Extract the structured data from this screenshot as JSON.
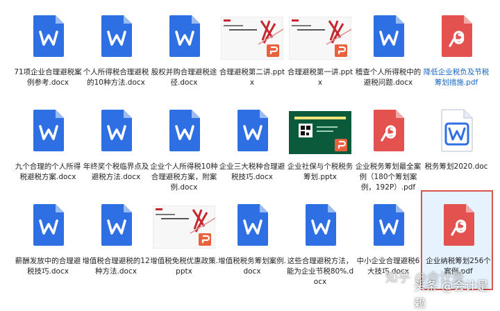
{
  "files": [
    {
      "name": "71项企业合理避税案例参考.docx",
      "type": "word"
    },
    {
      "name": "个人所得税合理避税的10种方法.docx",
      "type": "word"
    },
    {
      "name": "股权并购合理避税途径.docx",
      "type": "word"
    },
    {
      "name": "合理避税第二讲.pptx",
      "type": "pptx"
    },
    {
      "name": "合理避税第一讲.pptx",
      "type": "pptx"
    },
    {
      "name": "稽查个人所得税中的避税问题.docx",
      "type": "word"
    },
    {
      "name": "降低企业税负及节税筹划措施.pdf",
      "type": "pdf"
    },
    {
      "name": "九个合理的个人所得税避税方案.docx",
      "type": "word"
    },
    {
      "name": "年终奖个税临界点及避税方法.docx",
      "type": "word"
    },
    {
      "name": "企业个人所得税10种合理避税方案，附案例.docx",
      "type": "word"
    },
    {
      "name": "企业三大税种合理避税技巧.docx",
      "type": "word"
    },
    {
      "name": "企业社保与个税税务筹划.pptx",
      "type": "pptx-green"
    },
    {
      "name": "企业税务筹划最全案例（180个筹划案例，192P）.pdf",
      "type": "pdf"
    },
    {
      "name": "税务筹划2020.doc",
      "type": "word-outline"
    },
    {
      "name": "薪酬发放中的合理避税技巧.docx",
      "type": "word"
    },
    {
      "name": "增值税合理避税的12种方法.docx",
      "type": "word"
    },
    {
      "name": "增值税免税优惠政策.pptx",
      "type": "pptx"
    },
    {
      "name": "增值税税务筹划案例.docx",
      "type": "word"
    },
    {
      "name": "这些合理避税方法，能为企业节税80%.docx",
      "type": "word"
    },
    {
      "name": "中小企业合理避税6大技巧.docx",
      "type": "word"
    },
    {
      "name": "企业纳税筹划256个案例.pdf",
      "type": "pdf",
      "selected": true
    }
  ],
  "icons": {
    "word": "word-doc-icon",
    "word-outline": "word-doc-outline-icon",
    "pdf": "pdf-doc-icon",
    "pptx": "pptx-thumbnail-icon",
    "pptx-green": "pptx-thumbnail-green-icon"
  },
  "colors": {
    "word_blue": "#2f6fe4",
    "pdf_red": "#e4524f",
    "ppt_orange": "#e8613c",
    "selection_border": "#d9534f",
    "selection_bg": "#e6f3ff"
  },
  "watermarks": {
    "zhihu": "知乎 @会计是",
    "toutiao": "头条 @会计是赖"
  }
}
